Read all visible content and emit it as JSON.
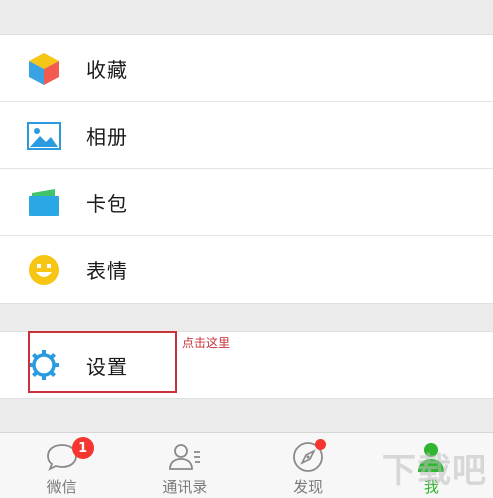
{
  "menu": {
    "items": [
      {
        "label": "收藏",
        "icon": "favorites-cube-icon"
      },
      {
        "label": "相册",
        "icon": "album-picture-icon"
      },
      {
        "label": "卡包",
        "icon": "card-wallet-icon"
      },
      {
        "label": "表情",
        "icon": "sticker-smiley-icon"
      }
    ],
    "settings": {
      "label": "设置",
      "icon": "gear-icon"
    }
  },
  "annotation": {
    "text": "点击这里",
    "color": "#c8323a"
  },
  "tabbar": {
    "tabs": [
      {
        "label": "微信",
        "icon": "chat-bubble-icon",
        "badge": "1"
      },
      {
        "label": "通讯录",
        "icon": "contacts-icon"
      },
      {
        "label": "发现",
        "icon": "compass-icon"
      },
      {
        "label": "我",
        "icon": "me-person-icon",
        "active": true
      }
    ],
    "active_color": "#2fb52f",
    "badge_color": "#f43530"
  },
  "watermark": "下载吧"
}
